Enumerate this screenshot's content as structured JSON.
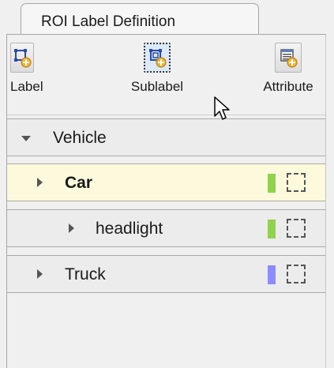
{
  "tab": {
    "title": "ROI Label Definition"
  },
  "toolbar": {
    "buttons": [
      {
        "label": "Label",
        "icon": "add-label-icon"
      },
      {
        "label": "Sublabel",
        "icon": "add-sublabel-icon"
      },
      {
        "label": "Attribute",
        "icon": "add-attribute-icon"
      }
    ]
  },
  "tree": [
    {
      "label": "Vehicle",
      "expanded": true,
      "type": "group"
    },
    {
      "label": "Car",
      "selected": true,
      "color": "#92d050"
    },
    {
      "label": "headlight",
      "color": "#92d050"
    },
    {
      "label": "Truck",
      "color": "#8c8cff"
    }
  ]
}
